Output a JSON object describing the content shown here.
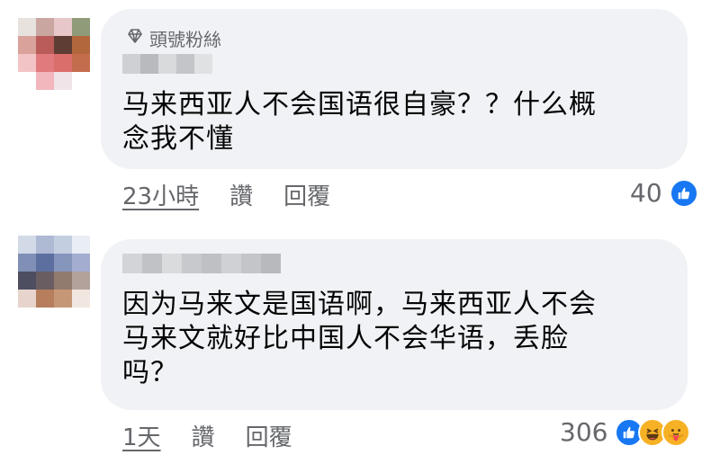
{
  "comments": [
    {
      "badge": "頭號粉絲",
      "text_line1": "马来西亚人不会国语很自豪？？什么概",
      "text_line2": "念我不懂",
      "time": "23小時",
      "like_label": "讚",
      "reply_label": "回覆",
      "reaction_count": "40"
    },
    {
      "text_line1": "因为马来文是国语啊，马来西亚人不会",
      "text_line2": "马来文就好比中国人不会华语，丢脸",
      "text_line3": "吗？",
      "time": "1天",
      "like_label": "讚",
      "reply_label": "回覆",
      "reaction_count": "306"
    }
  ],
  "icons": {
    "badge": "diamond-icon",
    "reactions_1": [
      "like-icon"
    ],
    "reactions_2": [
      "like-icon",
      "laugh-icon",
      "care-icon"
    ]
  },
  "colors": {
    "bubble": "#f0f2f5",
    "text": "#050505",
    "meta": "#65676b",
    "like_blue": "#1877f2",
    "emoji_yellow": "#f7b125"
  }
}
